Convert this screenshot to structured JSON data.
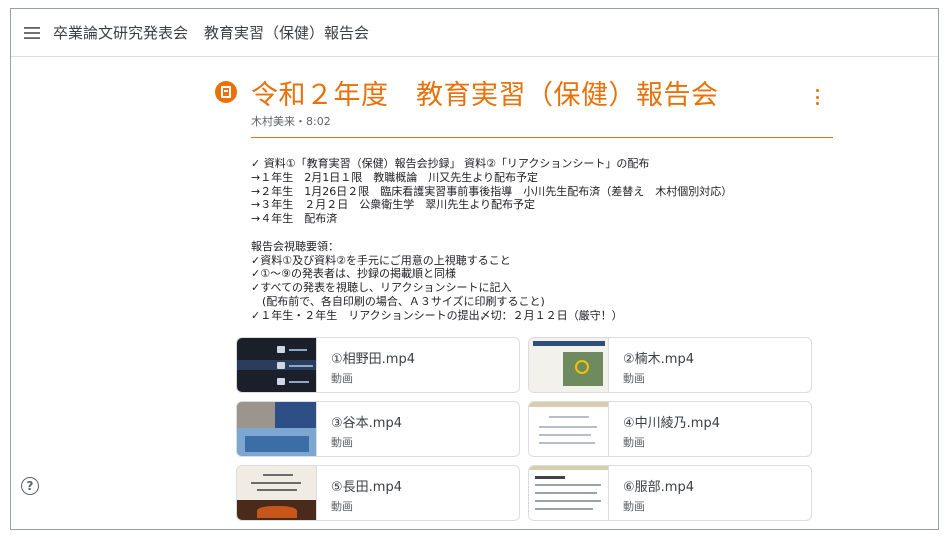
{
  "header": {
    "class_name": "卒業論文研究発表会",
    "page_name": "教育実習（保健）報告会"
  },
  "post": {
    "title": "令和２年度　教育実習（保健）報告会",
    "author_time": "木村美来・8:02",
    "accent_color": "#e8710a",
    "body": "✓ 資料①「教育実習（保健）報告会抄録」 資料②「リアクションシート」の配布\n→１年生　2月1日１限　教職概論　川又先生より配布予定\n→２年生　1月26日２限　臨床看護実習事前事後指導　小川先生配布済（差替え　木村個別対応）\n→３年生　２月２日　公衆衛生学　翠川先生より配布予定\n→４年生　配布済\n\n報告会視聴要領：\n✓資料①及び資料②を手元にご用意の上視聴すること\n✓①～⑨の発表者は、抄録の掲載順と同様\n✓すべての発表を視聴し、リアクションシートに記入\n　(配布前で、各自印刷の場合、Ａ３サイズに印刷すること)\n✓１年生・２年生　リアクションシートの提出〆切：２月１２日（厳守！）"
  },
  "attachments": [
    {
      "name": "①相野田.mp4",
      "type": "動画",
      "thumb": "slide-dark"
    },
    {
      "name": "②楠木.mp4",
      "type": "動画",
      "thumb": "slide-map"
    },
    {
      "name": "③谷本.mp4",
      "type": "動画",
      "thumb": "slide-photo"
    },
    {
      "name": "④中川綾乃.mp4",
      "type": "動画",
      "thumb": "slide-message"
    },
    {
      "name": "⑤長田.mp4",
      "type": "動画",
      "thumb": "slide-fire"
    },
    {
      "name": "⑥服部.mp4",
      "type": "動画",
      "thumb": "slide-text"
    }
  ],
  "icons": {
    "menu": "hamburger-menu-icon",
    "post": "material-icon",
    "more": "more-vert-icon",
    "help": "help-icon"
  }
}
